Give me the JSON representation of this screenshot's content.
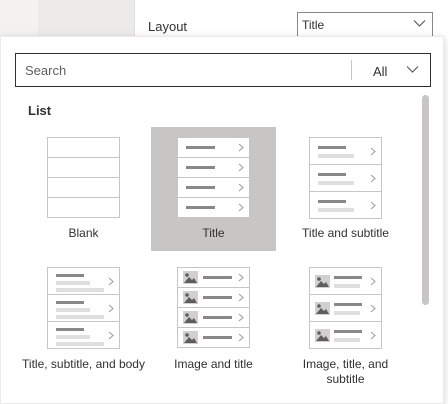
{
  "panel": {
    "layout_label": "Layout",
    "layout_value": "Title"
  },
  "search": {
    "placeholder": "Search",
    "filter_label": "All"
  },
  "section": {
    "title": "List"
  },
  "layouts": [
    {
      "label": "Blank",
      "selected": false
    },
    {
      "label": "Title",
      "selected": true
    },
    {
      "label": "Title and subtitle",
      "selected": false
    },
    {
      "label": "Title, subtitle, and body",
      "selected": false
    },
    {
      "label": "Image and title",
      "selected": false
    },
    {
      "label": "Image, title, and subtitle",
      "selected": false
    }
  ],
  "colors": {
    "selected_tile": "#c8c6c4",
    "preview_bar": "#8a8886",
    "preview_subline": "#e1dfdd"
  }
}
